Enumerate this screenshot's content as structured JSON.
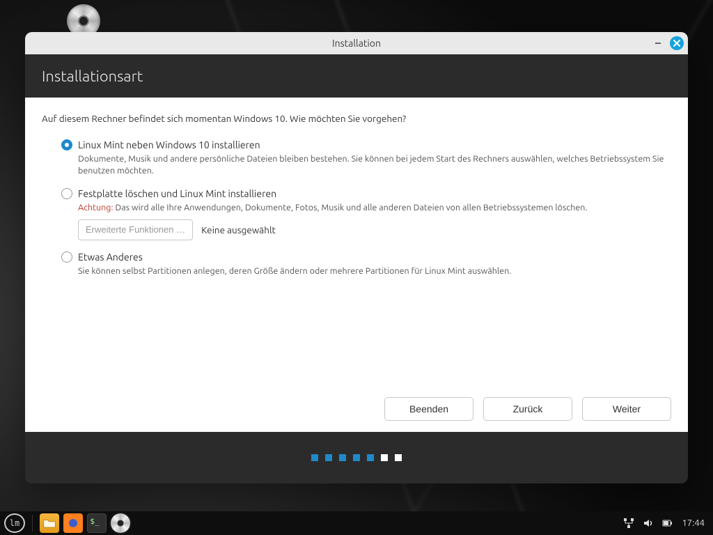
{
  "window": {
    "title": "Installation",
    "banner": "Installationsart"
  },
  "prompt": "Auf diesem Rechner befindet sich momentan Windows 10. Wie möchten Sie vorgehen?",
  "options": {
    "alongside": {
      "title": "Linux Mint neben Windows 10 installieren",
      "desc": "Dokumente, Musik und andere persönliche Dateien bleiben bestehen. Sie können bei jedem Start des Rechners auswählen, welches Betriebssystem Sie benutzen möchten.",
      "selected": true
    },
    "erase": {
      "title": "Festplatte löschen und Linux Mint installieren",
      "warn_label": "Achtung:",
      "warn_text": " Das wird alle Ihre Anwendungen, Dokumente, Fotos, Musik und alle anderen Dateien von allen Betriebssystemen löschen.",
      "advanced_button": "Erweiterte Funktionen …",
      "advanced_status": "Keine ausgewählt",
      "selected": false
    },
    "something_else": {
      "title": "Etwas Anderes",
      "desc": "Sie können selbst Partitionen anlegen, deren Größe ändern oder mehrere Partitionen für Linux Mint auswählen.",
      "selected": false
    }
  },
  "buttons": {
    "quit": "Beenden",
    "back": "Zurück",
    "continue": "Weiter"
  },
  "progress": {
    "total": 7,
    "current": 5
  },
  "taskbar": {
    "clock": "17:44"
  }
}
